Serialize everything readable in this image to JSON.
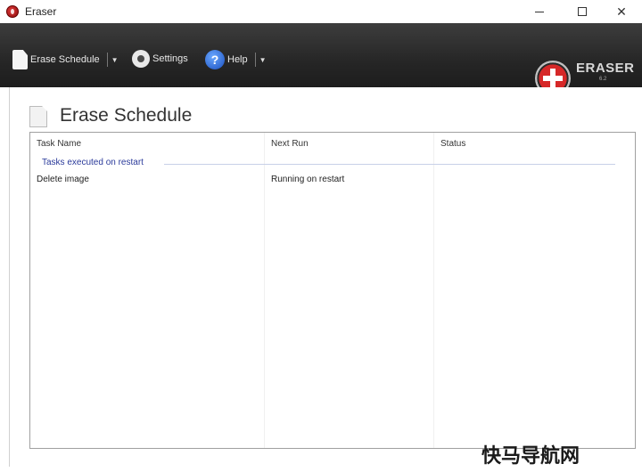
{
  "window": {
    "title": "Eraser",
    "minimize": "",
    "maximize": "",
    "close": "✕"
  },
  "toolbar": {
    "erase_schedule_label": "Erase Schedule",
    "settings_label": "Settings",
    "help_label": "Help",
    "dropdown_arrow": "▼"
  },
  "logo": {
    "text": "ERASER",
    "sub": "6.2"
  },
  "page": {
    "title": "Erase Schedule"
  },
  "task_list": {
    "columns": [
      "Task Name",
      "Next Run",
      "Status"
    ],
    "group_label": "Tasks executed on restart",
    "rows": [
      {
        "task_name": "Delete image",
        "next_run": "Running on restart",
        "status": ""
      }
    ]
  },
  "watermark": "快马导航网"
}
